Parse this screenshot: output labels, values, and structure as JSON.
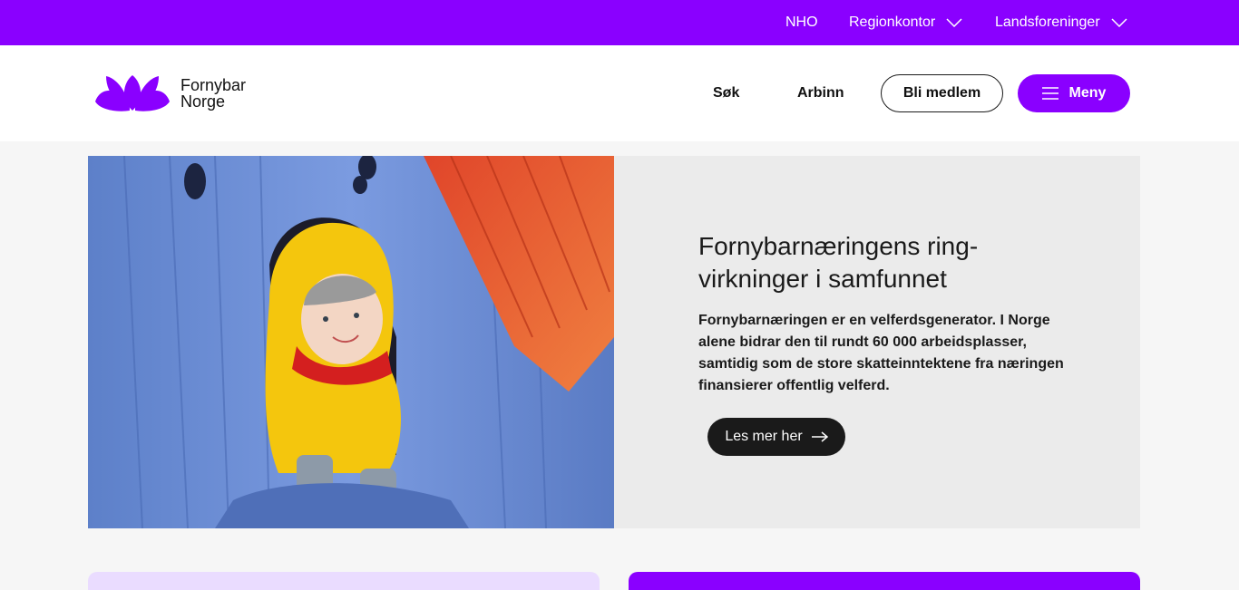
{
  "topbar": {
    "nho": "NHO",
    "regionkontor": "Regionkontor",
    "landsforeninger": "Landsforeninger"
  },
  "header": {
    "logo_line1": "Fornybar",
    "logo_line2": "Norge",
    "search": "Søk",
    "arbinn": "Arbinn",
    "member_button": "Bli medlem",
    "menu_button": "Meny"
  },
  "hero": {
    "title": "Fornybarnæringens ring-virkninger i samfunnet",
    "body": "Fornybarnæringen er en velferdsgenerator. I Norge alene bidrar den til rundt 60 000 arbeidsplasser, samtidig som de store skatteinntektene fra næringen finansierer offentlig velferd.",
    "button": "Les mer her"
  },
  "colors": {
    "brand": "#8a00ff",
    "panel": "#ebebeb",
    "dark": "#1a1a1a",
    "light_card": "#eadcff"
  },
  "icons": [
    "chevron-down-icon",
    "hamburger-icon",
    "arrow-right-icon",
    "logo-petals-icon"
  ]
}
